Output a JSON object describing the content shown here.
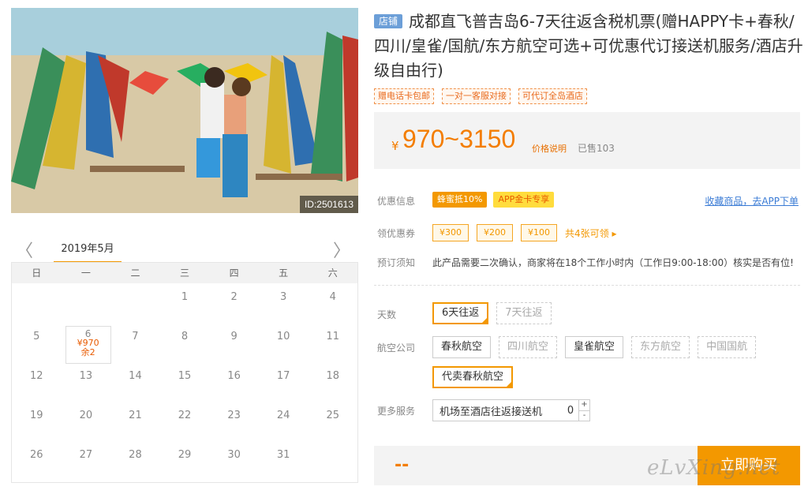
{
  "photo": {
    "id_label": "ID:2501613"
  },
  "calendar": {
    "prev": "〈",
    "next": "〉",
    "month": "2019年5月",
    "weekdays": [
      "日",
      "一",
      "二",
      "三",
      "四",
      "五",
      "六"
    ],
    "weeks": [
      [
        "",
        "",
        "",
        "1",
        "2",
        "3",
        "4"
      ],
      [
        "5",
        "6",
        "7",
        "8",
        "9",
        "10",
        "11"
      ],
      [
        "12",
        "13",
        "14",
        "15",
        "16",
        "17",
        "18"
      ],
      [
        "19",
        "20",
        "21",
        "22",
        "23",
        "24",
        "25"
      ],
      [
        "26",
        "27",
        "28",
        "29",
        "30",
        "31",
        ""
      ]
    ],
    "selected": {
      "day": "6",
      "price": "¥970",
      "stock": "余2"
    }
  },
  "product": {
    "shop_tag": "店铺",
    "title": "成都直飞普吉岛6-7天往返含税机票(赠HAPPY卡+春秋/四川/皇雀/国航/东方航空可选+可优惠代订接送机服务/酒店升级自由行)",
    "badges": [
      "赠电话卡包邮",
      "一对一客服对接",
      "可代订全岛酒店"
    ],
    "currency": "¥",
    "price": "970~3150",
    "price_note": "价格说明",
    "sold": "已售103"
  },
  "promo": {
    "label": "优惠信息",
    "tags": [
      "蜂蜜抵10%",
      "APP金卡专享"
    ],
    "fav_link": "收藏商品，去APP下单"
  },
  "coupons": {
    "label": "领优惠券",
    "items": [
      "¥300",
      "¥200",
      "¥100"
    ],
    "more": "共4张可领 ▸"
  },
  "notice": {
    "label": "预订须知",
    "text": "此产品需要二次确认，商家将在18个工作小时内（工作日9:00-18:00）核实是否有位!"
  },
  "days": {
    "label": "天数",
    "options": [
      "6天往返",
      "7天往返"
    ]
  },
  "airline": {
    "label": "航空公司",
    "options": [
      "春秋航空",
      "四川航空",
      "皇雀航空",
      "东方航空",
      "中国国航",
      "代卖春秋航空"
    ]
  },
  "service": {
    "label": "更多服务",
    "name": "机场至酒店往返接送机",
    "qty": "0",
    "plus": "+",
    "minus": "-"
  },
  "buy": {
    "total": "--",
    "button": "立即购买",
    "watermark": "eLvXing.net"
  }
}
